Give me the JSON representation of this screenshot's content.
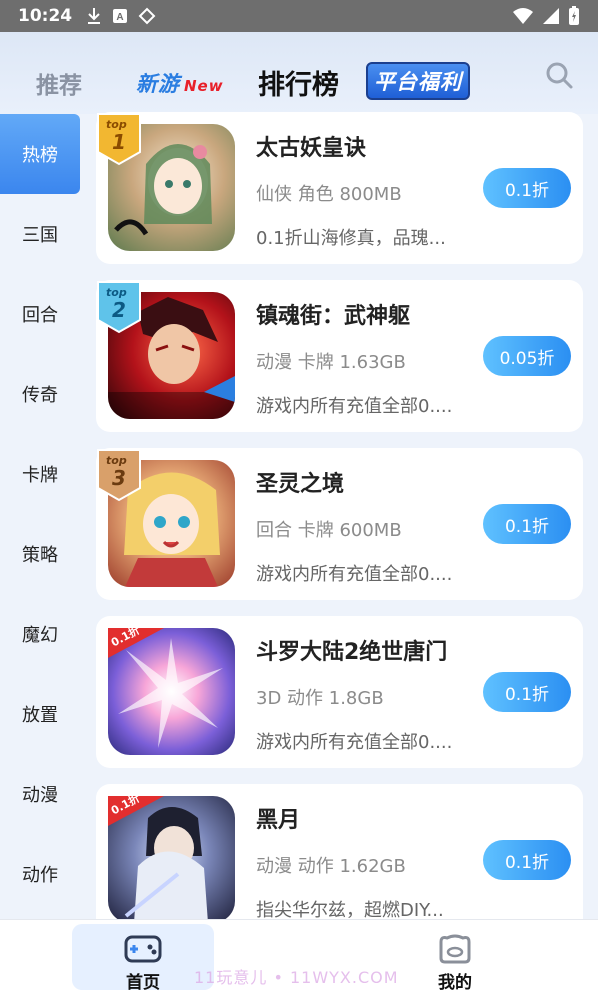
{
  "status_bar": {
    "time": "10:24"
  },
  "header": {
    "tab_recommend": "推荐",
    "tab_new": "新游",
    "tab_new_tag": "New",
    "tab_rank": "排行榜",
    "tab_welfare": "平台福利"
  },
  "sidebar": {
    "items": [
      {
        "label": "热榜"
      },
      {
        "label": "三国"
      },
      {
        "label": "回合"
      },
      {
        "label": "传奇"
      },
      {
        "label": "卡牌"
      },
      {
        "label": "策略"
      },
      {
        "label": "魔幻"
      },
      {
        "label": "放置"
      },
      {
        "label": "动漫"
      },
      {
        "label": "动作"
      }
    ]
  },
  "games": [
    {
      "title": "太古妖皇诀",
      "meta": "仙侠 角色 800MB",
      "desc": "0.1折山海修真，品瑰...",
      "discount": "0.1折",
      "rank_text": "top",
      "rank_num": "1"
    },
    {
      "title": "镇魂街：武神躯",
      "meta": "动漫 卡牌 1.63GB",
      "desc": "游戏内所有充值全部0....",
      "discount": "0.05折",
      "rank_text": "top",
      "rank_num": "2"
    },
    {
      "title": "圣灵之境",
      "meta": "回合 卡牌 600MB",
      "desc": "游戏内所有充值全部0....",
      "discount": "0.1折",
      "rank_text": "top",
      "rank_num": "3"
    },
    {
      "title": "斗罗大陆2绝世唐门",
      "meta": "3D 动作 1.8GB",
      "desc": "游戏内所有充值全部0....",
      "discount": "0.1折",
      "thumb_tag": "0.1折"
    },
    {
      "title": "黑月",
      "meta": "动漫 动作 1.62GB",
      "desc": "指尖华尔兹，超燃DIY...",
      "discount": "0.1折",
      "thumb_tag": "0.1折"
    }
  ],
  "bottom_nav": {
    "home_label": "首页",
    "mine_label": "我的"
  },
  "watermark": "11玩意儿 • 11WYX.COM",
  "colors": {
    "accent": "#3b86ee",
    "discount_start": "#5fc1ff",
    "discount_end": "#2b8ff2",
    "rank1": "#f2b731",
    "rank2": "#5fc3ea",
    "rank3": "#d9a06a"
  }
}
